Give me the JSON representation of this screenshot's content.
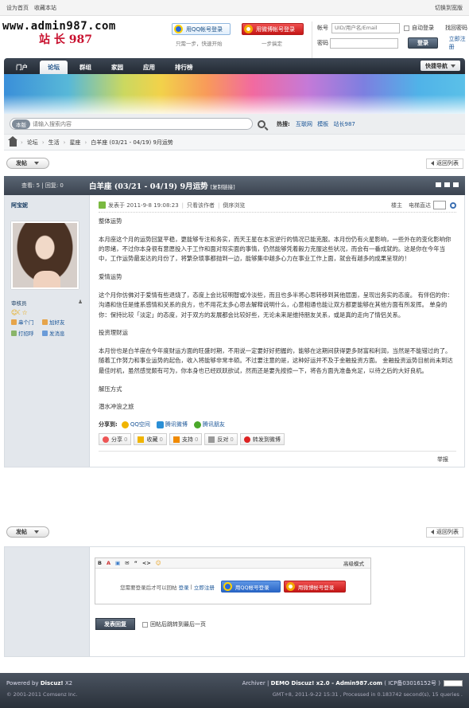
{
  "topbar": {
    "set_home": "设为首页",
    "bookmark": "收藏本站",
    "switch_width": "切换到宽版"
  },
  "logo": {
    "line1": "www.admin987.com",
    "line2": "站 长 987"
  },
  "social": {
    "qq_login": "用QQ帐号登录",
    "qq_sub": "只需一步，快速开始",
    "weibo_login": "用微博帐号登录",
    "weibo_sub": "一步搞定"
  },
  "login": {
    "account_label": "帐号",
    "account_placeholder": "UID/用户名/Email",
    "auto_login": "自动登录",
    "forgot": "找回密码",
    "password_label": "密码",
    "submit": "登录",
    "register": "立即注册"
  },
  "nav": {
    "items": [
      "门户",
      "论坛",
      "群组",
      "家园",
      "应用",
      "排行榜"
    ],
    "active": "论坛",
    "quick_nav": "快捷导航"
  },
  "search": {
    "category": "本版",
    "placeholder": "请输入搜索内容",
    "hot_label": "热搜:",
    "hot": [
      "互联网",
      "模板",
      "站长987"
    ]
  },
  "breadcrumb": [
    "论坛",
    "生活",
    "星座",
    "白羊座 (03/21 - 04/19) 9月运势"
  ],
  "buttons": {
    "post": "发帖",
    "back_list": "返回列表"
  },
  "thread": {
    "stats": "查看: 5 | 回复: 0",
    "title": "白羊座 (03/21 - 04/19) 9月运势",
    "copy_link": "[复制链接]"
  },
  "post": {
    "author": "阿宝妮",
    "group": "审核员",
    "stars": "☺☾☆",
    "actions": [
      "串个门",
      "加好友",
      "打招呼",
      "发消息"
    ],
    "posted_at": "发表于 2011-9-8 19:08:23",
    "only_author": "只看该作者",
    "reverse": "倒序浏览",
    "floor": "楼主",
    "goto": "电梯直达",
    "paragraphs": [
      "整体运势",
      "本月座这个月的运势回复平稳，更能够专注和务实，而天王星在本宫逆行的情况已能克服。本月份仍有火星影响，一些外在的变化影响你的思绪，不过你本身很有意愿投入于工作和面对现实面的事情，仍然能够凭着毅力克服这些状况，而会有一番成就的。这是你在今年当中，工作运势最发达的月份了，将繁杂琐事都抛到一边，能够集中越多心力在事业工作上面，就会有越多的成果呈现的！",
      "爱情运势",
      "这个月你仿佛对于爱情有些退烧了，态度上会比较明智或冷淡些，而且也多半将心思转移到其他层面，呈现出务实的态度。 有伴侣的你：沟通和信任是维系感情和关系的良方，也不用花太多心思去解释说明什么，心意相通也能让双方都更能够在其他方面有所发挥。 单身的你：保持比较「淡定」的态度，对于双方的发展都会比较好些，无论未来是维持朋友关系，或是真的走向了情侣关系。",
      "投资理财运",
      "本月份也是白羊座在今年度财运方面的旺盛时期，不用说一定要好好把握的，能够在这期间获得更多财富和利润，当然是不能错过的了。随着工作努力和事业运势的起色，收入将能够非常丰硕。不过要注意的是，这种好运并不及于金融投资方面。 金融投资运势目前尚未到达最佳时机，虽然感觉颇有可为，你本身也已经跃跃欲试，然而还是要先按捺一下，将各方面先准备充足，以待之后的大好良机。",
      "解压方式",
      "潜水冲浪之旅"
    ],
    "share_label": "分享到:",
    "share": [
      "QQ空间",
      "腾讯微博",
      "腾讯朋友"
    ],
    "votes": [
      {
        "label": "分享",
        "count": "0"
      },
      {
        "label": "收藏",
        "count": "0"
      },
      {
        "label": "支持",
        "count": "0"
      },
      {
        "label": "反对",
        "count": "0"
      },
      {
        "label": "转发到微博",
        "count": ""
      }
    ],
    "report": "举报"
  },
  "reply": {
    "toolbar": [
      "B",
      "A",
      "▣",
      "✉",
      "“",
      "<>",
      "☺"
    ],
    "advanced": "高级模式",
    "prompt": "您需要登录后才可以回帖",
    "login": "登录",
    "sep": "|",
    "register": "立即注册",
    "qq_login": "用QQ帐号登录",
    "weibo_login": "用微博帐号登录",
    "submit": "发表回复",
    "jump": "回帖后跳转到最后一页"
  },
  "footer": {
    "powered": "Powered by",
    "brand": "Discuz!",
    "ver": "X2",
    "copyright": "© 2001-2011 Comsenz Inc.",
    "right1a": "Archiver",
    "right1b": "DEMO Discuz! x2.0 - Admin987.com",
    "right1c": "( ICP备03016152号 )",
    "right2": "GMT+8, 2011-9-22 15:31 , Processed in 0.183742 second(s), 15 queries ."
  },
  "colors": {
    "nav_dark": "#2e3640",
    "accent_red": "#c8102e",
    "link": "#1a5597"
  }
}
